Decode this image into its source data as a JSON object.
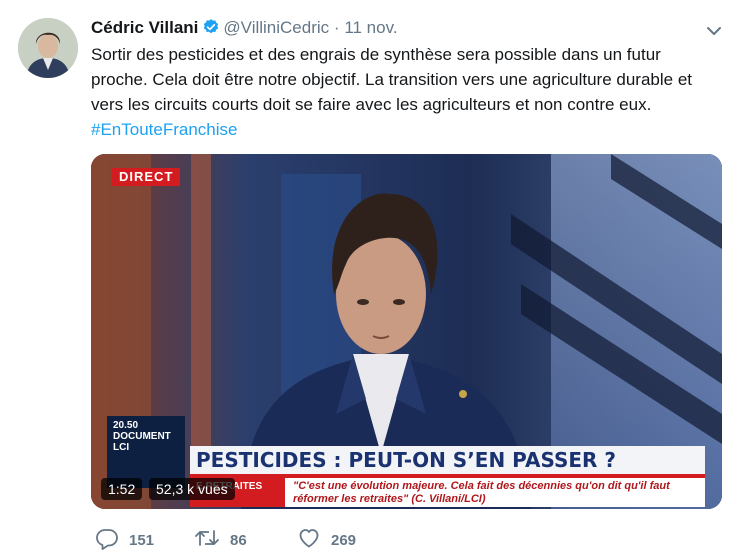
{
  "author": {
    "name": "Cédric Villani",
    "handle": "@VilliniCedric",
    "separator": "·",
    "time": "11 nov."
  },
  "tweet": {
    "text": "Sortir des pesticides et des engrais de synthèse sera possible dans un futur proche. Cela doit être notre objectif. La transition vers une agriculture durable et vers les circuits courts doit se faire avec les agriculteurs et non contre eux.",
    "hashtag": "#EnTouteFranchise"
  },
  "video": {
    "live_badge": "DIRECT",
    "program_time": "20.50",
    "program_name": "DOCUMENT LCI",
    "headline": "PESTICIDES : PEUT-ON S’EN PASSER ?",
    "sub_left": "E RETRAITES",
    "quote": "\"C'est une évolution majeure. Cela fait des décennies qu'on dit qu'il faut réformer les retraites\" (C. Villani/LCI)",
    "duration": "1:52",
    "views": "52,3 k vues"
  },
  "actions": {
    "replies": "151",
    "retweets": "86",
    "likes": "269"
  },
  "colors": {
    "accent": "#1da1f2",
    "muted": "#657786",
    "live_red": "#d31c1f"
  },
  "icons": [
    "verified-icon",
    "caret-down-icon",
    "reply-icon",
    "retweet-icon",
    "like-icon"
  ]
}
